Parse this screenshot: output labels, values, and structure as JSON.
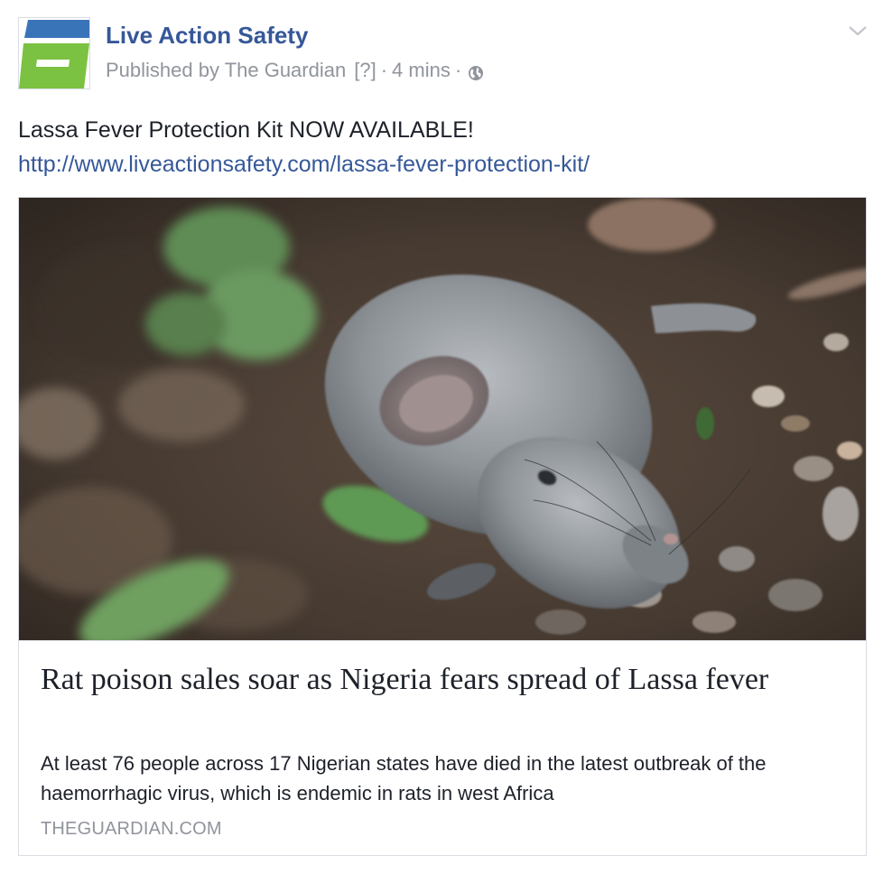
{
  "post": {
    "page_name": "Live Action Safety",
    "published_by": "Published by The Guardian",
    "help_marker": "[?]",
    "separator": "·",
    "time": "4 mins",
    "privacy_icon": "globe-icon",
    "menu_icon": "chevron-down-icon",
    "message": "Lassa Fever Protection Kit NOW AVAILABLE!",
    "link_url": "http://www.liveactionsafety.com/lassa-fever-protection-kit/"
  },
  "attachment": {
    "image_icon": "rat-photo",
    "title": "Rat poison sales soar as Nigeria fears spread of Lassa fever",
    "description": "At least 76 people across 17 Nigerian states have died in the latest outbreak of the haemorrhagic virus, which is endemic in rats in west Africa",
    "domain": "THEGUARDIAN.COM"
  },
  "colors": {
    "link_blue": "#365899",
    "meta_gray": "#90949c",
    "logo_blue": "#3a74b8",
    "logo_green": "#7cc242"
  }
}
